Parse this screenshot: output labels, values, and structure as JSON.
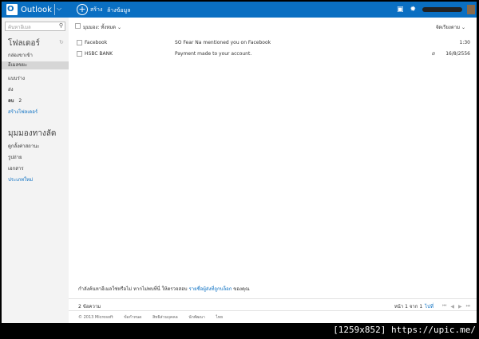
{
  "app": {
    "brand": "Outlook",
    "new_label": "สร้าง",
    "sweep_label": "ล้างข้อมูล"
  },
  "search": {
    "placeholder": "ค้นหาอีเมล"
  },
  "folders": {
    "heading": "โฟลเดอร์",
    "items": [
      {
        "label": "กล่องขาเข้า"
      },
      {
        "label": "อีเมลขยะ"
      },
      {
        "label": "แบบร่าง"
      },
      {
        "label": "ส่ง"
      },
      {
        "label": "ลบ",
        "count": "2"
      }
    ],
    "create_label": "สร้างโฟลเดอร์"
  },
  "quickviews": {
    "heading": "มุมมองทางลัด",
    "items": [
      {
        "label": "ดูกลั้งค่าสถานะ"
      },
      {
        "label": "รูปถ่าย"
      },
      {
        "label": "เอกสาร"
      }
    ],
    "new_category": "ประเภทใหม่"
  },
  "toolbar": {
    "filter_label": "มุมมอง: ทั้งหมด",
    "sort_label": "จัดเรียงตาม"
  },
  "messages": [
    {
      "from": "Facebook",
      "subject": "SO Fear Na mentioned you on Facebook",
      "date": "1:30",
      "attachment": false
    },
    {
      "from": "HSBC BANK",
      "subject": "Payment made to your account.",
      "date": "16/8/2556",
      "attachment": true
    }
  ],
  "notice": {
    "text": "กำลังค้นหาอีเมลใช่หรือไม่ หากไม่พบที่นี่ ให้ตรวจสอบ",
    "link": "รายชื่อผู้ส่งที่ถูกบล็อก",
    "suffix": " ของคุณ"
  },
  "status": {
    "count": "2 ข้อความ",
    "page": "หน้า 1 จาก 1",
    "go": "ไปที่"
  },
  "footer": {
    "copyright": "© 2013 Microsoft",
    "links": [
      "ข้อกำหนด",
      "สิทธิส่วนบุคคล",
      "นักพัฒนา",
      "ไทย"
    ]
  },
  "watermark": "[1259x852] https://upic.me/",
  "colors": {
    "accent": "#0a6fc2",
    "nav_bg": "#f3f3f3",
    "selected": "#d6d6d6"
  }
}
